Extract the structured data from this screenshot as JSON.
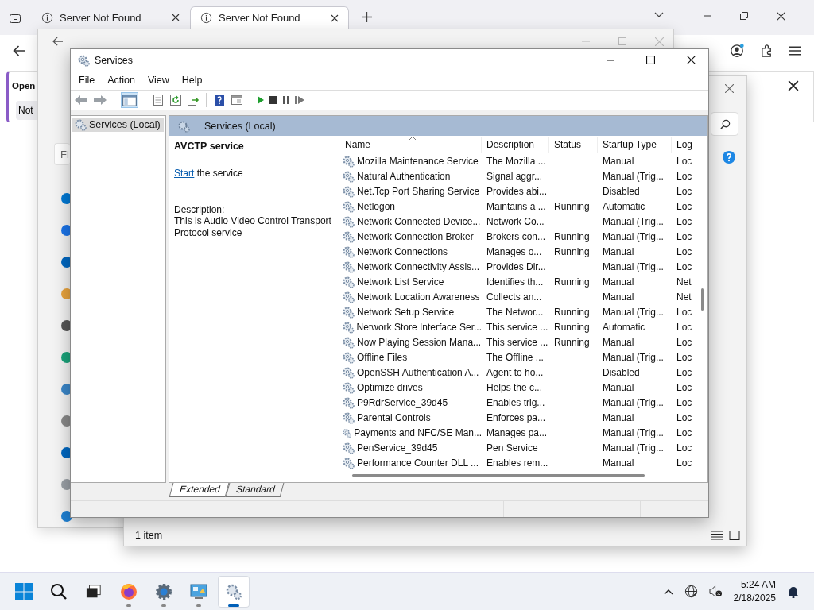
{
  "browser": {
    "tabs": [
      {
        "title": "Server Not Found",
        "selected": false
      },
      {
        "title": "Server Not Found",
        "selected": true
      }
    ],
    "notification": {
      "title": "Open",
      "button": "Not"
    }
  },
  "settings_window": {
    "search_value": "Fi"
  },
  "back_window": {
    "status": "1 item"
  },
  "services_window": {
    "title": "Services",
    "menu": [
      "File",
      "Action",
      "View",
      "Help"
    ],
    "tree": [
      {
        "label": "Services (Local)",
        "selected": true
      }
    ],
    "panel_title": "Services (Local)",
    "detail": {
      "name": "AVCTP service",
      "action_link": "Start",
      "action_text": "the service",
      "description_label": "Description:",
      "description": "This is Audio Video Control Transport Protocol service"
    },
    "columns": [
      "Name",
      "Description",
      "Status",
      "Startup Type",
      "Log"
    ],
    "rows": [
      {
        "name": "Mozilla Maintenance Service",
        "description": "The Mozilla ...",
        "startup_type": "Manual",
        "log_on_as": "Loc"
      },
      {
        "name": "Natural Authentication",
        "description": "Signal aggr...",
        "startup_type": "Manual (Trig...",
        "log_on_as": "Loc"
      },
      {
        "name": "Net.Tcp Port Sharing Service",
        "description": "Provides abi...",
        "startup_type": "Disabled",
        "log_on_as": "Loc"
      },
      {
        "name": "Netlogon",
        "description": "Maintains a ...",
        "status": "Running",
        "startup_type": "Automatic",
        "log_on_as": "Loc"
      },
      {
        "name": "Network Connected Device...",
        "description": "Network Co...",
        "startup_type": "Manual (Trig...",
        "log_on_as": "Loc"
      },
      {
        "name": "Network Connection Broker",
        "description": "Brokers con...",
        "status": "Running",
        "startup_type": "Manual (Trig...",
        "log_on_as": "Loc"
      },
      {
        "name": "Network Connections",
        "description": "Manages o...",
        "status": "Running",
        "startup_type": "Manual",
        "log_on_as": "Loc"
      },
      {
        "name": "Network Connectivity Assis...",
        "description": "Provides Dir...",
        "startup_type": "Manual (Trig...",
        "log_on_as": "Loc"
      },
      {
        "name": "Network List Service",
        "description": "Identifies th...",
        "status": "Running",
        "startup_type": "Manual",
        "log_on_as": "Net"
      },
      {
        "name": "Network Location Awareness",
        "description": "Collects an...",
        "startup_type": "Manual",
        "log_on_as": "Net"
      },
      {
        "name": "Network Setup Service",
        "description": "The Networ...",
        "status": "Running",
        "startup_type": "Manual (Trig...",
        "log_on_as": "Loc"
      },
      {
        "name": "Network Store Interface Ser...",
        "description": "This service ...",
        "status": "Running",
        "startup_type": "Automatic",
        "log_on_as": "Loc"
      },
      {
        "name": "Now Playing Session Mana...",
        "description": "This service ...",
        "status": "Running",
        "startup_type": "Manual",
        "log_on_as": "Loc"
      },
      {
        "name": "Offline Files",
        "description": "The Offline ...",
        "startup_type": "Manual (Trig...",
        "log_on_as": "Loc"
      },
      {
        "name": "OpenSSH Authentication A...",
        "description": "Agent to ho...",
        "startup_type": "Disabled",
        "log_on_as": "Loc"
      },
      {
        "name": "Optimize drives",
        "description": "Helps the c...",
        "startup_type": "Manual",
        "log_on_as": "Loc"
      },
      {
        "name": "P9RdrService_39d45",
        "description": "Enables trig...",
        "startup_type": "Manual (Trig...",
        "log_on_as": "Loc"
      },
      {
        "name": "Parental Controls",
        "description": "Enforces pa...",
        "startup_type": "Manual",
        "log_on_as": "Loc"
      },
      {
        "name": "Payments and NFC/SE Man...",
        "description": "Manages pa...",
        "startup_type": "Manual (Trig...",
        "log_on_as": "Loc"
      },
      {
        "name": "PenService_39d45",
        "description": "Pen Service",
        "startup_type": "Manual (Trig...",
        "log_on_as": "Loc"
      },
      {
        "name": "Performance Counter DLL ...",
        "description": "Enables rem...",
        "startup_type": "Manual",
        "log_on_as": "Loc"
      }
    ],
    "view_tabs": [
      {
        "label": "Extended",
        "selected": true
      },
      {
        "label": "Standard",
        "selected": false
      }
    ]
  },
  "taskbar": {
    "apps": [
      {
        "kind": "start",
        "running": false,
        "selected": false
      },
      {
        "kind": "search",
        "running": false,
        "selected": false
      },
      {
        "kind": "taskview",
        "running": false,
        "selected": false
      },
      {
        "kind": "browser",
        "running": true,
        "selected": false
      },
      {
        "kind": "settings",
        "running": true,
        "selected": false
      },
      {
        "kind": "controlpanel",
        "running": true,
        "selected": false
      },
      {
        "kind": "services",
        "running": true,
        "selected": true
      }
    ],
    "time": "5:24 AM",
    "date": "2/18/2025"
  }
}
